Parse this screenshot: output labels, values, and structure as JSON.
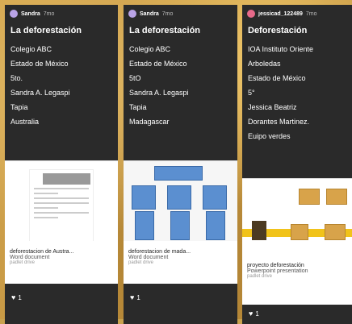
{
  "cards": [
    {
      "author": "Sandra",
      "time": "7mo",
      "title": "La deforestación",
      "lines": [
        "Colegio ABC",
        "Estado de México",
        "5to.",
        "Sandra A. Legaspi",
        "Tapia",
        "Australia"
      ],
      "file_name": "deforestacion de Austra...",
      "file_type": "Word document",
      "source": "padlet drive",
      "likes": "1"
    },
    {
      "author": "Sandra",
      "time": "7mo",
      "title": "La deforestación",
      "lines": [
        "Colegio ABC",
        "Estado de México",
        "5tO",
        "Sandra A. Legaspi",
        "Tapia",
        "Madagascar"
      ],
      "file_name": "deforestacion de mada...",
      "file_type": "Word document",
      "source": "padlet drive",
      "likes": "1"
    },
    {
      "author": "jessicad_122489",
      "time": "7mo",
      "title": "Deforestación",
      "lines": [
        "IOA Instituto Oriente",
        "Arboledas",
        "Estado de México",
        "5°",
        "Jessica Beatriz",
        "Dorantes Martinez.",
        "Euipo verdes"
      ],
      "file_name": "proyecto deforestación",
      "file_type": "Powerpoint presentation",
      "source": "padlet drive",
      "likes": "1"
    }
  ],
  "colors": {
    "card_bg": "#2a2a2a",
    "backdrop": "#c9a24e",
    "avatar_purple": "#b9a3e6",
    "avatar_pink": "#e76a8a",
    "diagram_blue": "#5b8fd0",
    "ppt_yellow": "#f1c31a"
  },
  "icons": [
    "avatar",
    "heart-icon"
  ]
}
